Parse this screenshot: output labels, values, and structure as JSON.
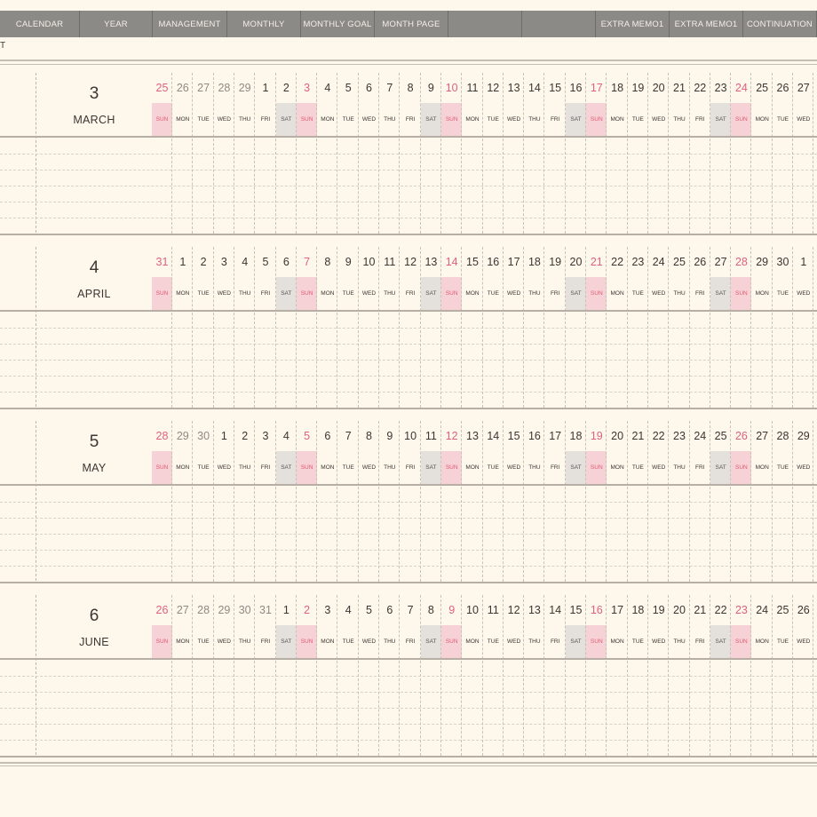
{
  "nav": {
    "tabs": [
      "CALENDAR",
      "YEAR",
      "MANAGEMENT",
      "MONTHLY",
      "MONTHLY GOAL",
      "MONTH PAGE",
      "",
      "",
      "EXTRA MEMO1",
      "EXTRA MEMO1",
      "CONTINUATION"
    ]
  },
  "top_label": "T",
  "dow_labels": [
    "SUN",
    "MON",
    "TUE",
    "WED",
    "THU",
    "FRI",
    "SAT"
  ],
  "colors": {
    "sunday": "#e0627a",
    "sunday_bg": "#f6d1d6",
    "saturday_bg": "#e4e1dc",
    "nav_bg": "#8c8a87"
  },
  "months": [
    {
      "number": "3",
      "name": "MARCH",
      "days": [
        "25",
        "26",
        "27",
        "28",
        "29",
        "1",
        "2",
        "3",
        "4",
        "5",
        "6",
        "7",
        "8",
        "9",
        "10",
        "11",
        "12",
        "13",
        "14",
        "15",
        "16",
        "17",
        "18",
        "19",
        "20",
        "21",
        "22",
        "23",
        "24",
        "25",
        "26",
        "27"
      ],
      "faded_count": 5
    },
    {
      "number": "4",
      "name": "APRIL",
      "days": [
        "31",
        "1",
        "2",
        "3",
        "4",
        "5",
        "6",
        "7",
        "8",
        "9",
        "10",
        "11",
        "12",
        "13",
        "14",
        "15",
        "16",
        "17",
        "18",
        "19",
        "20",
        "21",
        "22",
        "23",
        "24",
        "25",
        "26",
        "27",
        "28",
        "29",
        "30",
        "1"
      ],
      "faded_count": 1
    },
    {
      "number": "5",
      "name": "MAY",
      "days": [
        "28",
        "29",
        "30",
        "1",
        "2",
        "3",
        "4",
        "5",
        "6",
        "7",
        "8",
        "9",
        "10",
        "11",
        "12",
        "13",
        "14",
        "15",
        "16",
        "17",
        "18",
        "19",
        "20",
        "21",
        "22",
        "23",
        "24",
        "25",
        "26",
        "27",
        "28",
        "29"
      ],
      "faded_count": 3
    },
    {
      "number": "6",
      "name": "JUNE",
      "days": [
        "26",
        "27",
        "28",
        "29",
        "30",
        "31",
        "1",
        "2",
        "3",
        "4",
        "5",
        "6",
        "7",
        "8",
        "9",
        "10",
        "11",
        "12",
        "13",
        "14",
        "15",
        "16",
        "17",
        "18",
        "19",
        "20",
        "21",
        "22",
        "23",
        "24",
        "25",
        "26"
      ],
      "faded_count": 6
    }
  ]
}
